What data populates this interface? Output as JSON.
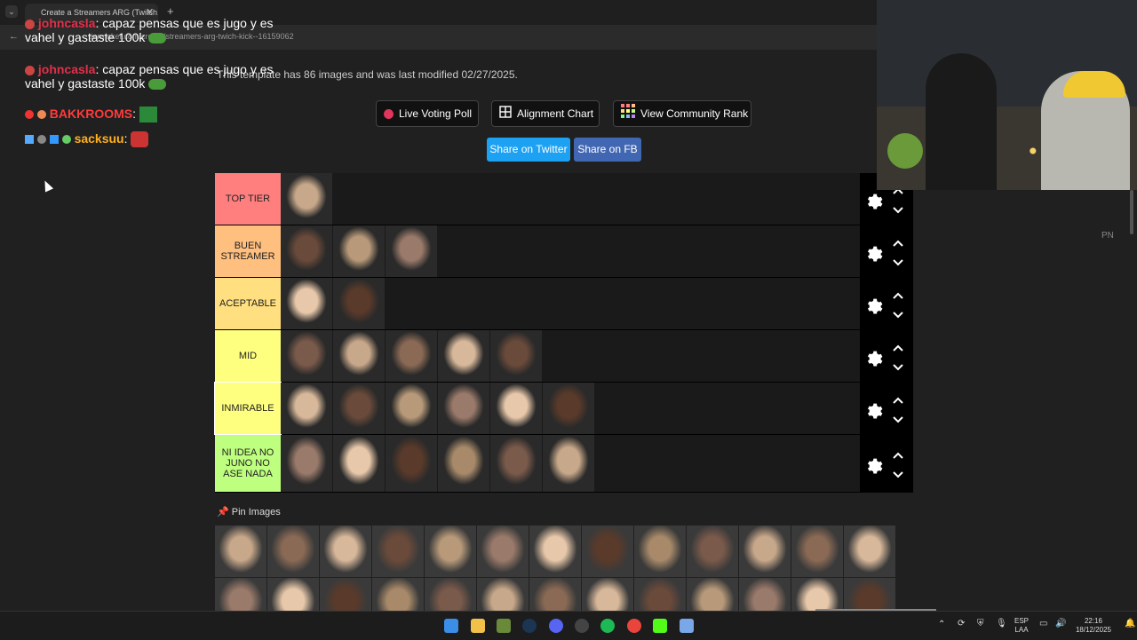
{
  "browser": {
    "tab_title": "Create a Streamers ARG (Twitch...",
    "url": "tiermaker.com/create/streamers-arg-twich-kick--16159062"
  },
  "page": {
    "modified_text": "This template has 86 images and was last modified 02/27/2025.",
    "buttons": {
      "live_voting": "Live Voting Poll",
      "alignment": "Alignment Chart",
      "community": "View Community Rank",
      "twitter": "Share on Twitter",
      "facebook": "Share on FB"
    },
    "pin_images": "Pin Images",
    "side_label": "PN"
  },
  "tiers": [
    {
      "label": "TOP TIER",
      "color": "#ff7f7f",
      "count": 1
    },
    {
      "label": "BUEN STREAMER",
      "color": "#ffbf7f",
      "count": 3
    },
    {
      "label": "ACEPTABLE",
      "color": "#ffdf7f",
      "count": 2
    },
    {
      "label": "MID",
      "color": "#ffff7f",
      "count": 5
    },
    {
      "label": "INMIRABLE",
      "color": "#ffff7f",
      "count": 6
    },
    {
      "label": "NI IDEA NO JUNO NO ASE NADA",
      "color": "#bfff7f",
      "count": 6
    }
  ],
  "chat": [
    {
      "user": "johncasla",
      "message": ": capaz pensas que es jugo y es",
      "line2": "vahel y gastaste 100k",
      "user_color": "#e0304a"
    },
    {
      "user": "BAKKROOMS",
      "message": ":",
      "user_color": "#ff3b3b"
    },
    {
      "user": "sacksuu",
      "message": ":",
      "user_color": "#ffb020"
    }
  ],
  "taskbar": {
    "lang": "ESP",
    "lang2": "LAA",
    "time": "22:16",
    "date": "18/12/2025"
  }
}
